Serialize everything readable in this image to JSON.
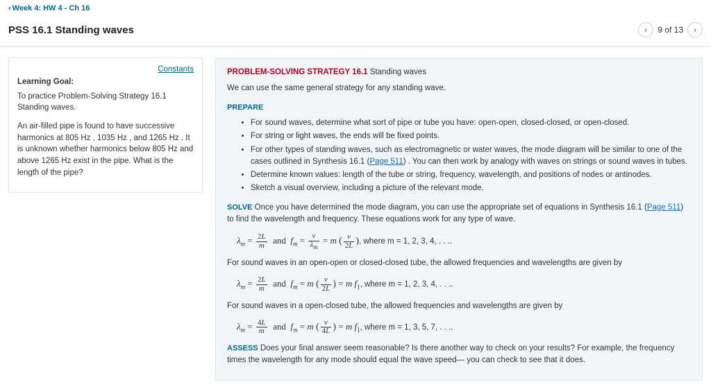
{
  "nav": {
    "back_label": "Week 4: HW 4 - Ch 16"
  },
  "title": "PSS 16.1 Standing waves",
  "pager": {
    "label": "9 of 13"
  },
  "left": {
    "constants": "Constants",
    "lg_head": "Learning Goal:",
    "lg_body": "To practice Problem-Solving Strategy 16.1 Standing waves.",
    "problem": "An air-filled pipe is found to have successive harmonics at 805 Hz , 1035 Hz , and 1265 Hz . It is unknown whether harmonics below 805 Hz and above 1265 Hz exist in the pipe. What is the length of the pipe?"
  },
  "right": {
    "head_red": "PROBLEM-SOLVING STRATEGY 16.1",
    "head_rest": " Standing waves",
    "intro": "We can use the same general strategy for any standing wave.",
    "prepare_label": "PREPARE",
    "prepare_items": [
      "For sound waves, determine what sort of pipe or tube you have: open-open, closed-closed, or open-closed.",
      "For string or light waves, the ends will be fixed points.",
      "For other types of standing waves, such as electromagnetic or water waves, the mode diagram will be similar to one of the cases outlined in Synthesis 16.1 (",
      "Determine known values: length of the tube or string, frequency, wavelength, and positions of nodes or antinodes.",
      "Sketch a visual overview, including a picture of the relevant mode."
    ],
    "page511": "Page 511",
    "prepare_item3_tail": ") . You can then work by analogy with waves on strings or sound waves in tubes.",
    "solve_label": "SOLVE",
    "solve_text": " Once you have determined the mode diagram, you can use the appropriate set of equations in Synthesis 16.1 (",
    "solve_tail": ") to find the wavelength and frequency. These equations work for any type of wave.",
    "where1": ", where m = 1, 2, 3, 4, . . ..",
    "openopen": "For sound waves in an open-open or closed-closed tube, the allowed frequencies and wavelengths are given by",
    "where2": ", where m = 1, 2, 3, 4, . . ..",
    "openclosed": "For sound waves in a open-closed tube, the allowed frequencies and wavelengths are given by",
    "where3": ", where m = 1, 3, 5, 7, . . ..",
    "assess_label": "ASSESS",
    "assess_text": " Does your final answer seem reasonable? Is there another way to check on your results? For example, the frequency times the wavelength for any mode should equal the wave speed— you can check to see that it does."
  }
}
